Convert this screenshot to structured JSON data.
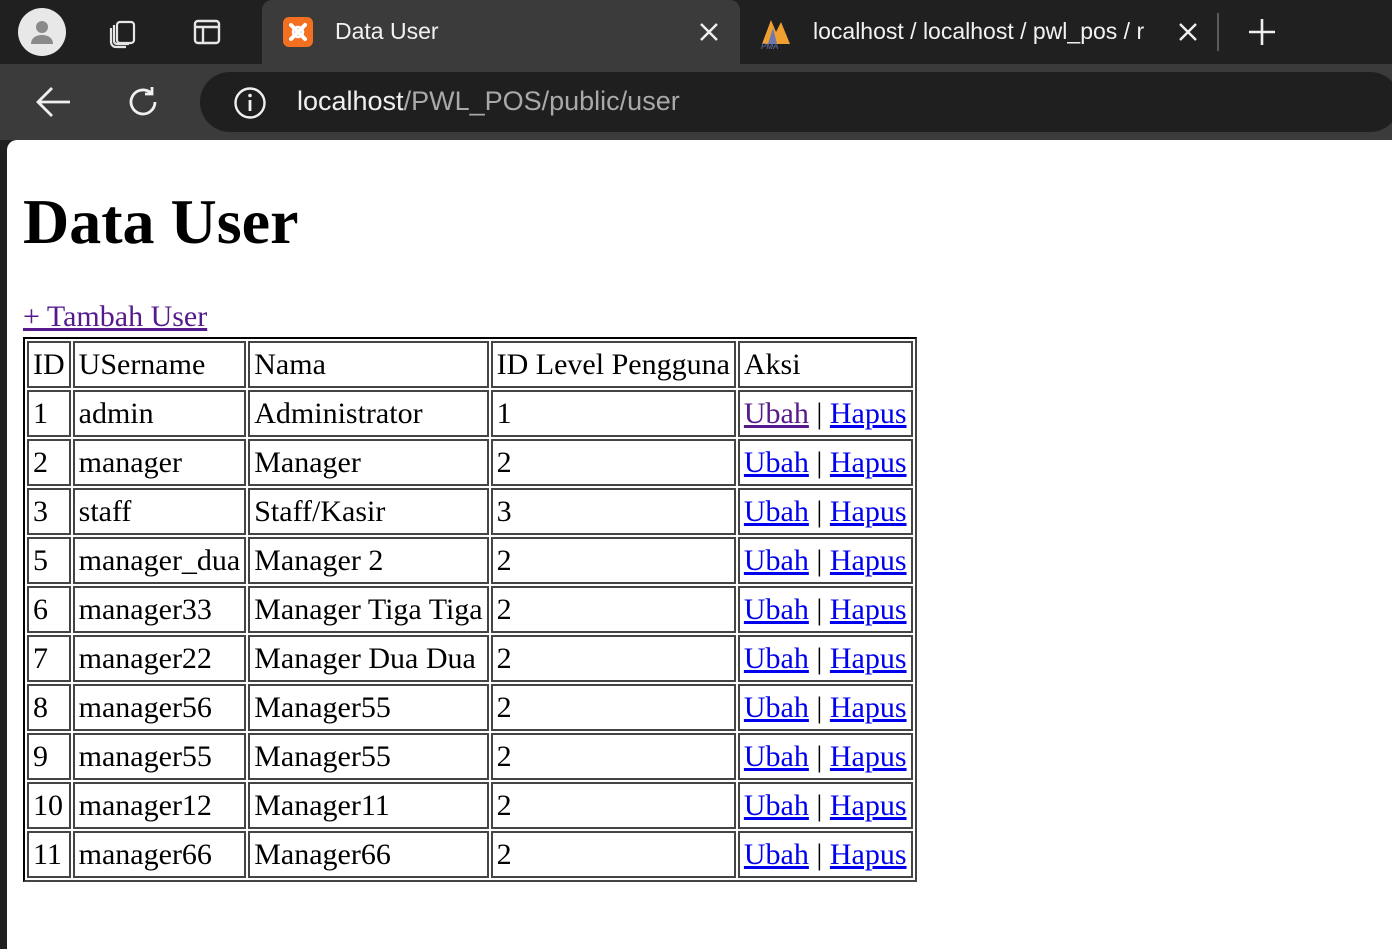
{
  "browser": {
    "tabs": [
      {
        "title": "Data User",
        "favicon": "xampp-icon",
        "active": true
      },
      {
        "title": "localhost / localhost / pwl_pos / r",
        "favicon": "phpmyadmin-icon",
        "active": false
      }
    ],
    "address": {
      "host": "localhost",
      "path": "/PWL_POS/public/user"
    }
  },
  "page": {
    "heading": "Data User",
    "add_link": "+ Tambah User",
    "table": {
      "headers": [
        "ID",
        "USername",
        "Nama",
        "ID Level Pengguna",
        "Aksi"
      ],
      "action_edit": "Ubah",
      "action_sep": "|",
      "action_delete": "Hapus",
      "rows": [
        {
          "id": "1",
          "username": "admin",
          "nama": "Administrator",
          "level": "1"
        },
        {
          "id": "2",
          "username": "manager",
          "nama": "Manager",
          "level": "2"
        },
        {
          "id": "3",
          "username": "staff",
          "nama": "Staff/Kasir",
          "level": "3"
        },
        {
          "id": "5",
          "username": "manager_dua",
          "nama": "Manager 2",
          "level": "2"
        },
        {
          "id": "6",
          "username": "manager33",
          "nama": "Manager Tiga Tiga",
          "level": "2"
        },
        {
          "id": "7",
          "username": "manager22",
          "nama": "Manager Dua Dua",
          "level": "2"
        },
        {
          "id": "8",
          "username": "manager56",
          "nama": "Manager55",
          "level": "2"
        },
        {
          "id": "9",
          "username": "manager55",
          "nama": "Manager55",
          "level": "2"
        },
        {
          "id": "10",
          "username": "manager12",
          "nama": "Manager11",
          "level": "2"
        },
        {
          "id": "11",
          "username": "manager66",
          "nama": "Manager66",
          "level": "2"
        }
      ]
    }
  },
  "colors": {
    "link": "#0000ee",
    "visited_link": "#551a8b",
    "tab_strip": "#202020",
    "toolbar": "#3b3b3b"
  }
}
